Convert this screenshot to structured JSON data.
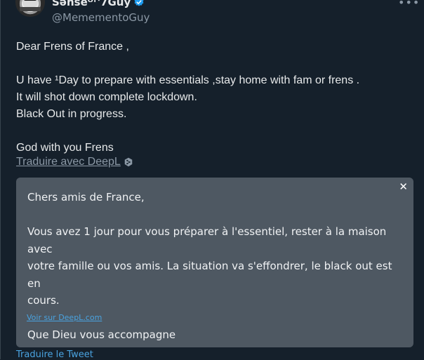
{
  "tweet": {
    "display_name": "Sənseᴼᶠ'7Guy",
    "handle": "@MemementoGuy",
    "more_icon": "more-horizontal-icon",
    "text": "Dear Frens of France ,\n\nU have ¹Day to prepare with essentials ,stay home with fam or frens .\nIt will shot down complete lockdown.\nBlack Out in progress.\n\nGod with you Frens",
    "translate_deepl_label": "Traduire avec DeepL",
    "translate_tweet_label": "Traduire le Tweet"
  },
  "deepl_panel": {
    "translation": "Chers amis de France,\n\nVous avez 1 jour pour vous préparer à l'essentiel, rester à la maison avec\nvotre famille ou vos amis. La situation va s'effondrer, le black out est en\ncours.\n\nQue Dieu vous accompagne",
    "view_link": "Voir sur DeepL.com",
    "close_icon": "close-icon"
  },
  "colors": {
    "background": "#15202b",
    "panel": "#4e5862",
    "verified": "#1d9bf0",
    "link": "#4aa3e0",
    "muted": "#8b98a5"
  }
}
